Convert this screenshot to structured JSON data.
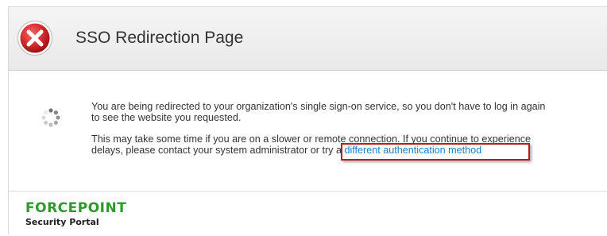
{
  "header": {
    "title": "SSO Redirection Page",
    "icon": "error-icon"
  },
  "message": {
    "line1": "You are being redirected to your organization's single sign-on service, so you don't have to log in again",
    "line2": "to see the website you requested.",
    "line3": "This may take some time if you are on a slower or remote connection. If you continue to experience",
    "line4_prefix": "delays, please contact your system administrator or try a ",
    "link_text": "different authentication method"
  },
  "footer": {
    "brand": "FORCEPOINT",
    "subtitle": "Security Portal"
  },
  "colors": {
    "link": "#1a7fc1",
    "highlight_border": "#c4161c",
    "brand_green": "#2e9a2e",
    "error_red": "#d8282b"
  }
}
